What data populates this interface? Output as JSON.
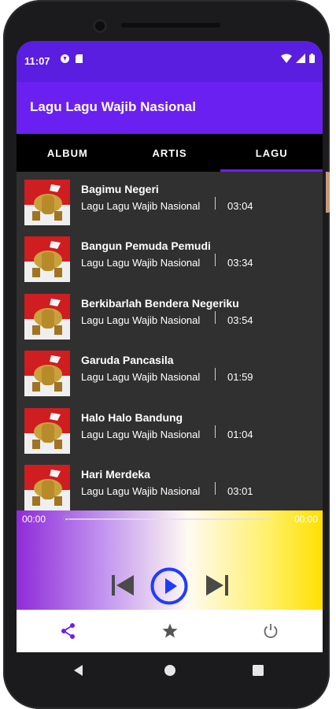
{
  "status_bar": {
    "time": "11:07"
  },
  "app_bar": {
    "title": "Lagu Lagu Wajib Nasional"
  },
  "tabs": [
    {
      "label": "ALBUM",
      "active": false
    },
    {
      "label": "ARTIS",
      "active": false
    },
    {
      "label": "LAGU",
      "active": true
    }
  ],
  "songs": [
    {
      "title": "Bagimu Negeri",
      "artist": "Lagu Lagu Wajib Nasional",
      "duration": "03:04"
    },
    {
      "title": "Bangun Pemuda Pemudi",
      "artist": "Lagu Lagu Wajib Nasional",
      "duration": "03:34"
    },
    {
      "title": "Berkibarlah Bendera Negeriku",
      "artist": "Lagu Lagu Wajib Nasional",
      "duration": "03:54"
    },
    {
      "title": "Garuda Pancasila",
      "artist": "Lagu Lagu Wajib Nasional",
      "duration": "01:59"
    },
    {
      "title": "Halo Halo Bandung",
      "artist": "Lagu Lagu Wajib Nasional",
      "duration": "01:04"
    },
    {
      "title": "Hari Merdeka",
      "artist": "Lagu Lagu Wajib Nasional",
      "duration": "03:01"
    }
  ],
  "player": {
    "current_time": "00:00",
    "total_time": "00:00",
    "progress": 0,
    "controls": [
      "skip-previous-icon",
      "play-icon",
      "skip-next-icon"
    ]
  },
  "bottom_nav": [
    "share-icon",
    "star-icon",
    "power-icon"
  ],
  "colors": {
    "status_bar": "#5a1ee0",
    "app_bar": "#6a20f0",
    "accent": "#6a20f0",
    "list_background": "#303030",
    "play_button": "#1f3cff"
  }
}
